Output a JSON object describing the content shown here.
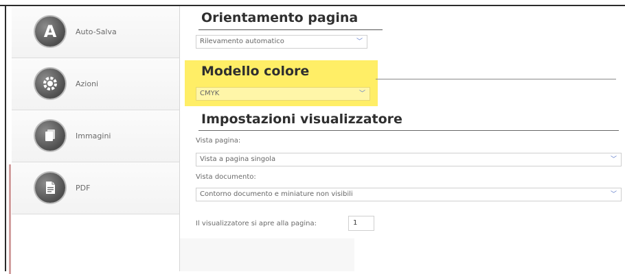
{
  "sidebar": {
    "items": [
      {
        "label": "Auto-Salva",
        "icon": "autosave-icon",
        "glyph": "A"
      },
      {
        "label": "Azioni",
        "icon": "gear-icon",
        "glyph": "⚙"
      },
      {
        "label": "Immagini",
        "icon": "images-icon",
        "glyph": "▣"
      },
      {
        "label": "PDF",
        "icon": "pdf-icon",
        "glyph": "🗎"
      }
    ]
  },
  "orientation": {
    "title": "Orientamento pagina",
    "value": "Rilevamento automatico"
  },
  "color_model": {
    "title": "Modello colore",
    "value": "CMYK"
  },
  "viewer": {
    "title": "Impostazioni visualizzatore",
    "page_view_label": "Vista pagina:",
    "page_view_value": "Vista a pagina singola",
    "doc_view_label": "Vista documento:",
    "doc_view_value": "Contorno documento e miniature non visibili",
    "open_page_label": "Il visualizzatore si apre alla pagina:",
    "open_page_value": "1"
  },
  "colors": {
    "highlight": "#ffec55",
    "chevron": "#5a78c8"
  }
}
